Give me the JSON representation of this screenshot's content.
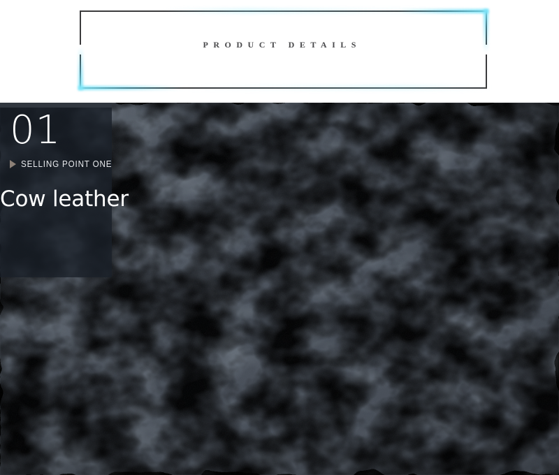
{
  "banner": {
    "title": "PRODUCT DETAILS",
    "frame_color": "#3b3b3d",
    "glow_color": "#5ad4f0",
    "background": "#ffffff"
  },
  "photo": {
    "alt_name": "cow-leather-grain-texture",
    "base_color": "#4c525a",
    "crevice_color": "#262b33",
    "highlight_color": "#737b85"
  },
  "panel": {
    "number": "01",
    "marker_icon": "play-triangle-icon",
    "marker_color": "#8c8077",
    "subtitle": "SELLING POINT ONE",
    "headline": "Cow leather",
    "overlay_color": "#1a2029",
    "cap_color": "#8e9094",
    "text_color": "#ffffff"
  }
}
